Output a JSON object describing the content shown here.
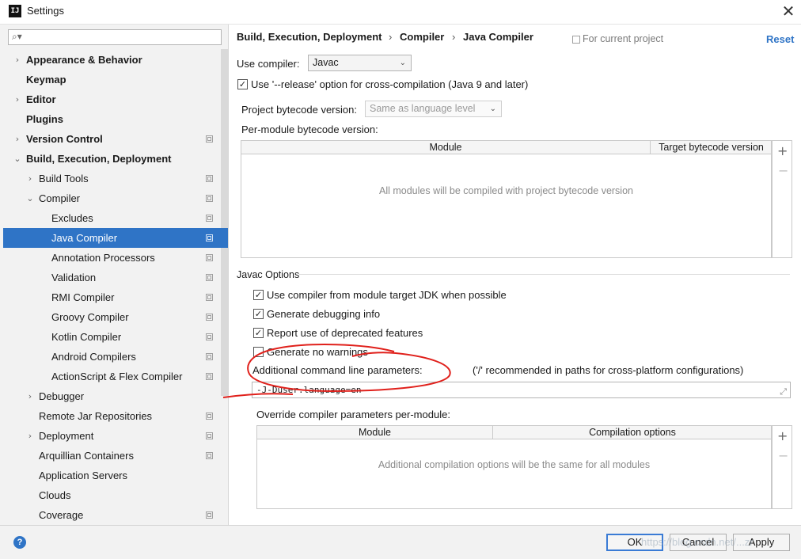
{
  "window": {
    "title": "Settings",
    "app_icon": "intellij-icon",
    "close_glyph": "✕"
  },
  "search": {
    "placeholder": "",
    "icon_glyph": "⌕▾"
  },
  "tree": [
    {
      "label": "Appearance & Behavior",
      "bold": true,
      "expander": "›",
      "project": false
    },
    {
      "label": "Keymap",
      "bold": true,
      "expander": "",
      "project": false
    },
    {
      "label": "Editor",
      "bold": true,
      "expander": "›",
      "project": false
    },
    {
      "label": "Plugins",
      "bold": true,
      "expander": "",
      "project": false
    },
    {
      "label": "Version Control",
      "bold": true,
      "expander": "›",
      "project": true
    },
    {
      "label": "Build, Execution, Deployment",
      "bold": true,
      "expander": "⌄",
      "project": false
    },
    {
      "label": "Build Tools",
      "bold": false,
      "expander": "›",
      "project": true
    },
    {
      "label": "Compiler",
      "bold": false,
      "expander": "⌄",
      "project": true
    },
    {
      "label": "Excludes",
      "bold": false,
      "expander": "",
      "project": true
    },
    {
      "label": "Java Compiler",
      "bold": false,
      "expander": "",
      "project": true,
      "selected": true
    },
    {
      "label": "Annotation Processors",
      "bold": false,
      "expander": "",
      "project": true
    },
    {
      "label": "Validation",
      "bold": false,
      "expander": "",
      "project": true
    },
    {
      "label": "RMI Compiler",
      "bold": false,
      "expander": "",
      "project": true
    },
    {
      "label": "Groovy Compiler",
      "bold": false,
      "expander": "",
      "project": true
    },
    {
      "label": "Kotlin Compiler",
      "bold": false,
      "expander": "",
      "project": true
    },
    {
      "label": "Android Compilers",
      "bold": false,
      "expander": "",
      "project": true
    },
    {
      "label": "ActionScript & Flex Compiler",
      "bold": false,
      "expander": "",
      "project": true
    },
    {
      "label": "Debugger",
      "bold": false,
      "expander": "›",
      "project": false
    },
    {
      "label": "Remote Jar Repositories",
      "bold": false,
      "expander": "",
      "project": true
    },
    {
      "label": "Deployment",
      "bold": false,
      "expander": "›",
      "project": true
    },
    {
      "label": "Arquillian Containers",
      "bold": false,
      "expander": "",
      "project": true
    },
    {
      "label": "Application Servers",
      "bold": false,
      "expander": "",
      "project": false
    },
    {
      "label": "Clouds",
      "bold": false,
      "expander": "",
      "project": false
    },
    {
      "label": "Coverage",
      "bold": false,
      "expander": "",
      "project": true
    }
  ],
  "breadcrumb": {
    "parts": [
      "Build, Execution, Deployment",
      "Compiler",
      "Java Compiler"
    ],
    "separator": "›"
  },
  "for_current_project": "For current project",
  "reset": "Reset",
  "use_compiler": {
    "label": "Use compiler:",
    "value": "Javac",
    "arrow": "⌄"
  },
  "release_option": {
    "label": "Use '--release' option for cross-compilation (Java 9 and later)",
    "checked": true
  },
  "project_bytecode": {
    "label": "Project bytecode version:",
    "value": "Same as language level",
    "arrow": "⌄"
  },
  "per_module": {
    "label": "Per-module bytecode version:",
    "columns": [
      "Module",
      "Target bytecode version"
    ],
    "empty": "All modules will be compiled with project bytecode version",
    "add": "+",
    "remove": "−"
  },
  "javac_options": {
    "section_label": "Javac Options",
    "checks": [
      {
        "label": "Use compiler from module target JDK when possible",
        "checked": true
      },
      {
        "label": "Generate debugging info",
        "checked": true
      },
      {
        "label": "Report use of deprecated features",
        "checked": true
      },
      {
        "label": "Generate no warnings",
        "checked": false
      }
    ],
    "additional_label": "Additional command line parameters:",
    "hint": "('/' recommended in paths for cross-platform configurations)",
    "additional_value": "-J-Duser.language=en",
    "expand_glyph": "⤢"
  },
  "override": {
    "label": "Override compiler parameters per-module:",
    "columns": [
      "Module",
      "Compilation options"
    ],
    "empty": "Additional compilation options will be the same for all modules",
    "add": "+",
    "remove": "−"
  },
  "buttons": {
    "ok": "OK",
    "cancel": "Cancel",
    "apply": "Apply"
  },
  "help": "?",
  "check_glyph": "✓",
  "watermark": "https://blog.csdn.net/...zr",
  "colors": {
    "selection": "#2f74c6",
    "link": "#2f74c6",
    "annotation": "#e0201b"
  }
}
